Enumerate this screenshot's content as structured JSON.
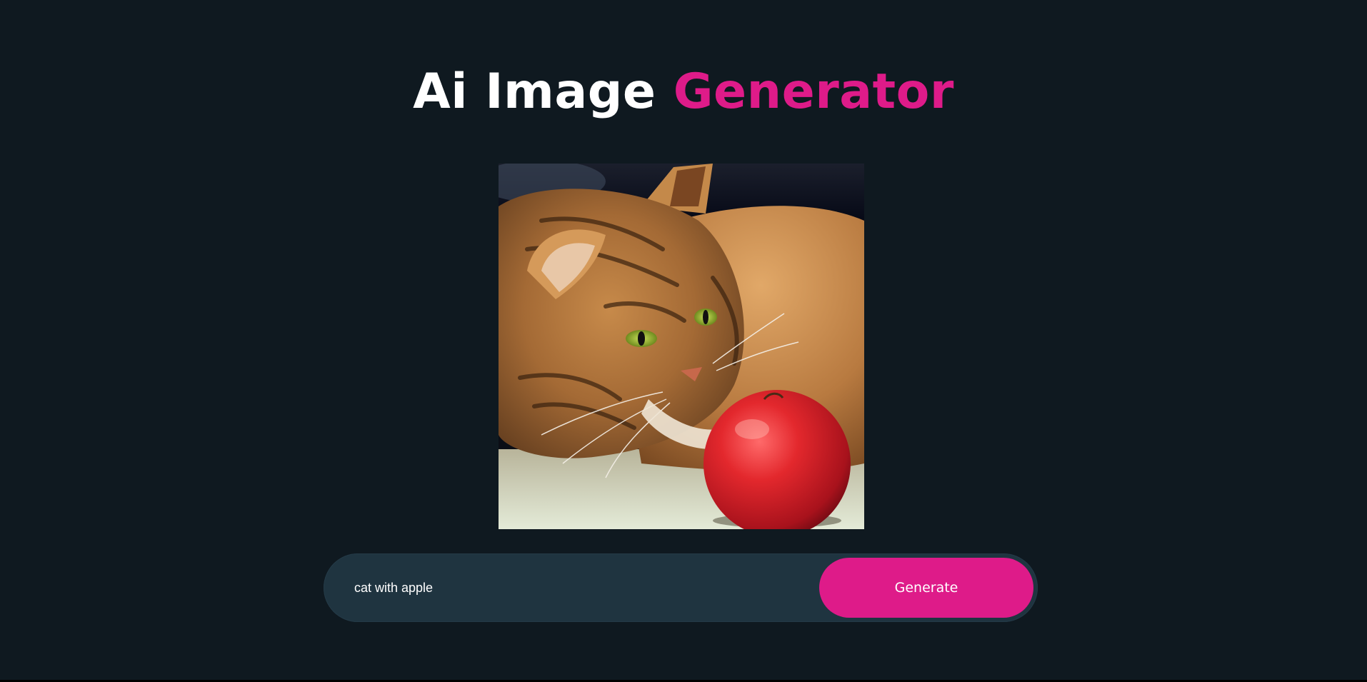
{
  "header": {
    "title_main": "Ai Image",
    "title_accent": "Generator"
  },
  "generated_image": {
    "subject": "cat-with-apple"
  },
  "prompt_bar": {
    "input_value": "cat with apple",
    "button_label": "Generate"
  },
  "colors": {
    "background": "#0f1920",
    "accent": "#de1b89",
    "input_bar": "#1f3440",
    "text": "#ffffff"
  }
}
